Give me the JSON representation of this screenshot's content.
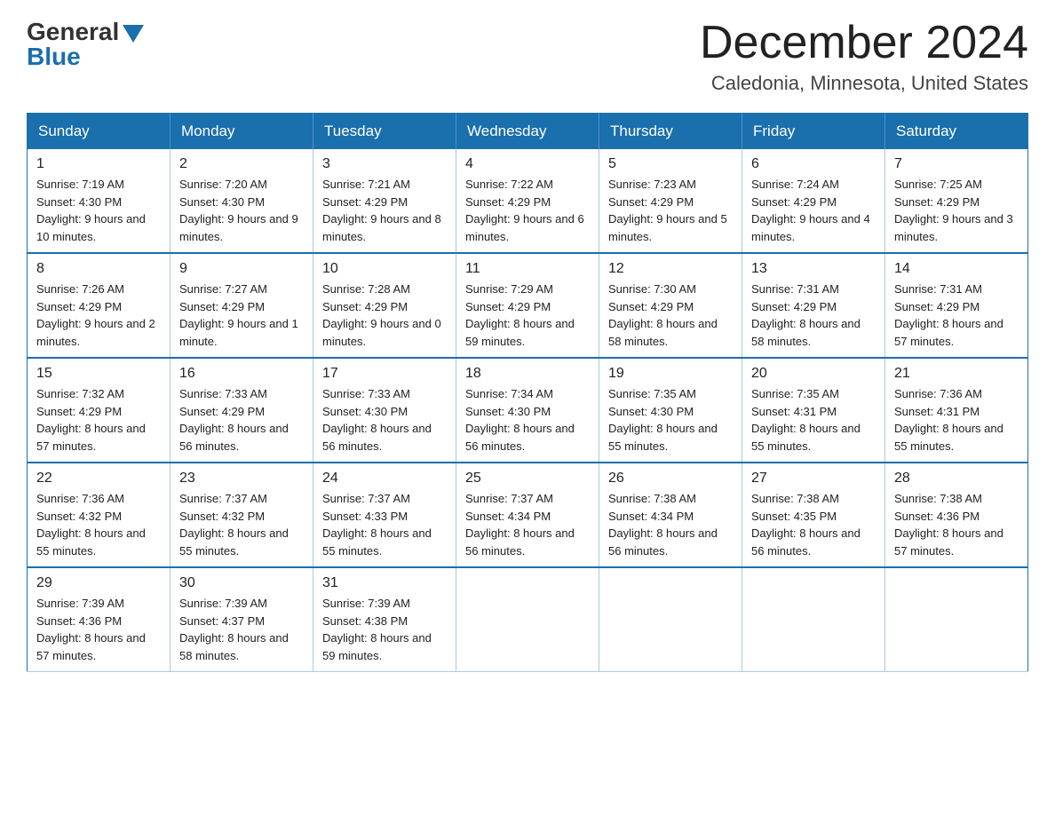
{
  "logo": {
    "general": "General",
    "blue": "Blue"
  },
  "title": "December 2024",
  "subtitle": "Caledonia, Minnesota, United States",
  "days": [
    "Sunday",
    "Monday",
    "Tuesday",
    "Wednesday",
    "Thursday",
    "Friday",
    "Saturday"
  ],
  "weeks": [
    [
      {
        "day": "1",
        "sunrise": "7:19 AM",
        "sunset": "4:30 PM",
        "daylight": "9 hours and 10 minutes."
      },
      {
        "day": "2",
        "sunrise": "7:20 AM",
        "sunset": "4:30 PM",
        "daylight": "9 hours and 9 minutes."
      },
      {
        "day": "3",
        "sunrise": "7:21 AM",
        "sunset": "4:29 PM",
        "daylight": "9 hours and 8 minutes."
      },
      {
        "day": "4",
        "sunrise": "7:22 AM",
        "sunset": "4:29 PM",
        "daylight": "9 hours and 6 minutes."
      },
      {
        "day": "5",
        "sunrise": "7:23 AM",
        "sunset": "4:29 PM",
        "daylight": "9 hours and 5 minutes."
      },
      {
        "day": "6",
        "sunrise": "7:24 AM",
        "sunset": "4:29 PM",
        "daylight": "9 hours and 4 minutes."
      },
      {
        "day": "7",
        "sunrise": "7:25 AM",
        "sunset": "4:29 PM",
        "daylight": "9 hours and 3 minutes."
      }
    ],
    [
      {
        "day": "8",
        "sunrise": "7:26 AM",
        "sunset": "4:29 PM",
        "daylight": "9 hours and 2 minutes."
      },
      {
        "day": "9",
        "sunrise": "7:27 AM",
        "sunset": "4:29 PM",
        "daylight": "9 hours and 1 minute."
      },
      {
        "day": "10",
        "sunrise": "7:28 AM",
        "sunset": "4:29 PM",
        "daylight": "9 hours and 0 minutes."
      },
      {
        "day": "11",
        "sunrise": "7:29 AM",
        "sunset": "4:29 PM",
        "daylight": "8 hours and 59 minutes."
      },
      {
        "day": "12",
        "sunrise": "7:30 AM",
        "sunset": "4:29 PM",
        "daylight": "8 hours and 58 minutes."
      },
      {
        "day": "13",
        "sunrise": "7:31 AM",
        "sunset": "4:29 PM",
        "daylight": "8 hours and 58 minutes."
      },
      {
        "day": "14",
        "sunrise": "7:31 AM",
        "sunset": "4:29 PM",
        "daylight": "8 hours and 57 minutes."
      }
    ],
    [
      {
        "day": "15",
        "sunrise": "7:32 AM",
        "sunset": "4:29 PM",
        "daylight": "8 hours and 57 minutes."
      },
      {
        "day": "16",
        "sunrise": "7:33 AM",
        "sunset": "4:29 PM",
        "daylight": "8 hours and 56 minutes."
      },
      {
        "day": "17",
        "sunrise": "7:33 AM",
        "sunset": "4:30 PM",
        "daylight": "8 hours and 56 minutes."
      },
      {
        "day": "18",
        "sunrise": "7:34 AM",
        "sunset": "4:30 PM",
        "daylight": "8 hours and 56 minutes."
      },
      {
        "day": "19",
        "sunrise": "7:35 AM",
        "sunset": "4:30 PM",
        "daylight": "8 hours and 55 minutes."
      },
      {
        "day": "20",
        "sunrise": "7:35 AM",
        "sunset": "4:31 PM",
        "daylight": "8 hours and 55 minutes."
      },
      {
        "day": "21",
        "sunrise": "7:36 AM",
        "sunset": "4:31 PM",
        "daylight": "8 hours and 55 minutes."
      }
    ],
    [
      {
        "day": "22",
        "sunrise": "7:36 AM",
        "sunset": "4:32 PM",
        "daylight": "8 hours and 55 minutes."
      },
      {
        "day": "23",
        "sunrise": "7:37 AM",
        "sunset": "4:32 PM",
        "daylight": "8 hours and 55 minutes."
      },
      {
        "day": "24",
        "sunrise": "7:37 AM",
        "sunset": "4:33 PM",
        "daylight": "8 hours and 55 minutes."
      },
      {
        "day": "25",
        "sunrise": "7:37 AM",
        "sunset": "4:34 PM",
        "daylight": "8 hours and 56 minutes."
      },
      {
        "day": "26",
        "sunrise": "7:38 AM",
        "sunset": "4:34 PM",
        "daylight": "8 hours and 56 minutes."
      },
      {
        "day": "27",
        "sunrise": "7:38 AM",
        "sunset": "4:35 PM",
        "daylight": "8 hours and 56 minutes."
      },
      {
        "day": "28",
        "sunrise": "7:38 AM",
        "sunset": "4:36 PM",
        "daylight": "8 hours and 57 minutes."
      }
    ],
    [
      {
        "day": "29",
        "sunrise": "7:39 AM",
        "sunset": "4:36 PM",
        "daylight": "8 hours and 57 minutes."
      },
      {
        "day": "30",
        "sunrise": "7:39 AM",
        "sunset": "4:37 PM",
        "daylight": "8 hours and 58 minutes."
      },
      {
        "day": "31",
        "sunrise": "7:39 AM",
        "sunset": "4:38 PM",
        "daylight": "8 hours and 59 minutes."
      },
      null,
      null,
      null,
      null
    ]
  ]
}
